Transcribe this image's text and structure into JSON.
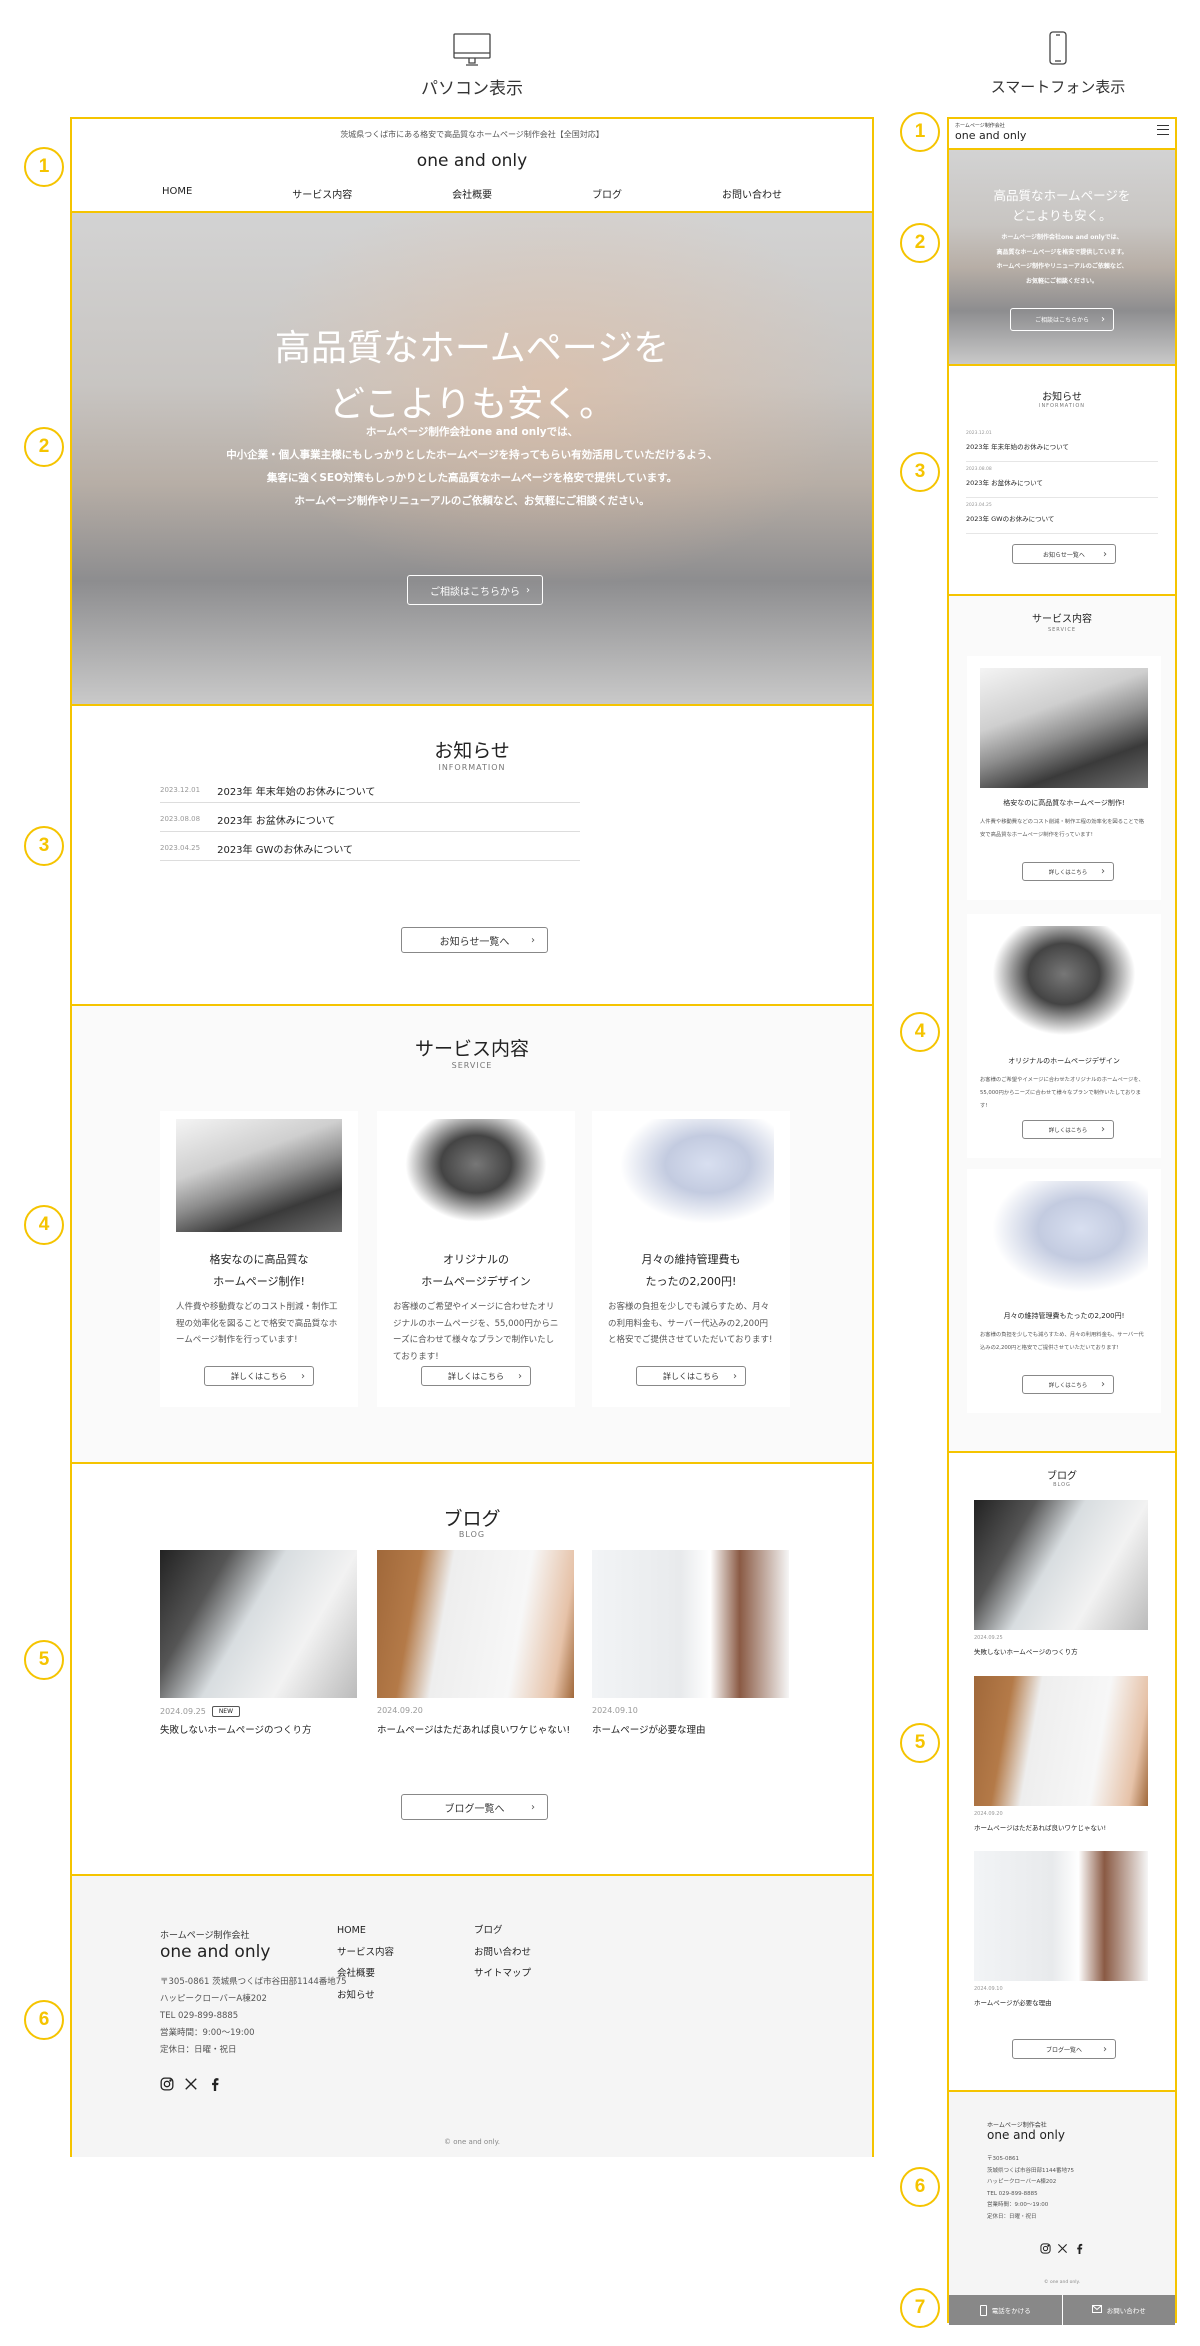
{
  "labels": {
    "pc": "パソコン表示",
    "sp": "スマートフォン表示"
  },
  "markers": [
    "1",
    "2",
    "3",
    "4",
    "5",
    "6",
    "7"
  ],
  "colors": {
    "accent": "#F5C400",
    "footer_bg": "#f5f5f5",
    "sp_bar": "#888888"
  },
  "header": {
    "tagline": "茨城県つくば市にある格安で高品質なホームページ制作会社【全国対応】",
    "logo": "one and only",
    "sp_tagline": "ホームページ制作会社",
    "nav": [
      "HOME",
      "サービス内容",
      "会社概要",
      "ブログ",
      "お問い合わせ"
    ]
  },
  "hero": {
    "title_lines": [
      "高品質なホームページを",
      "どこよりも安く。"
    ],
    "text_lines": [
      "ホームページ制作会社one and onlyでは、",
      "中小企業・個人事業主様にもしっかりとしたホームページを持ってもらい有効活用していただけるよう、",
      "集客に強くSEO対策もしっかりとした高品質なホームページを格安で提供しています。",
      "ホームページ制作やリニューアルのご依頼など、お気軽にご相談ください。"
    ],
    "sp_text_lines": [
      "ホームページ制作会社one and onlyでは、",
      "高品質なホームページを格安で提供しています。",
      "ホームページ制作やリニューアルのご依頼など、",
      "お気軽にご相談ください。"
    ],
    "button": "ご相談はこちらから"
  },
  "news": {
    "title": "お知らせ",
    "sub": "INFORMATION",
    "items": [
      {
        "date": "2023.12.01",
        "title": "2023年 年末年始のお休みについて"
      },
      {
        "date": "2023.08.08",
        "title": "2023年 お盆休みについて"
      },
      {
        "date": "2023.04.25",
        "title": "2023年 GWのお休みについて"
      }
    ],
    "button": "お知らせ一覧へ"
  },
  "service": {
    "title": "サービス内容",
    "sub": "SERVICE",
    "items": [
      {
        "title_lines": [
          "格安なのに高品質な",
          "ホームページ制作!"
        ],
        "body": "人件費や移動費などのコスト削減・制作工程の効率化を図ることで格安で高品質なホームページ制作を行っています!",
        "image": "laptop-keyboard"
      },
      {
        "title_lines": [
          "オリジナルの",
          "ホームページデザイン"
        ],
        "body": "お客様のご希望やイメージに合わせたオリジナルのホームページを、55,000円からニーズに合わせて様々なプランで制作いたしております!",
        "image": "responsive-devices"
      },
      {
        "title_lines": [
          "月々の維持管理費も",
          "たったの2,200円!"
        ],
        "body": "お客様の負担を少しでも減らすため、月々の利用料金も、サーバー代込みの2,200円と格安でご提供させていただいております!",
        "image": "calculator-hand"
      }
    ],
    "button": "詳しくはこちら"
  },
  "blog": {
    "title": "ブログ",
    "sub": "BLOG",
    "items": [
      {
        "date": "2024.09.25",
        "badge": "NEW",
        "title": "失敗しないホームページのつくり方",
        "image": "laptop-coffee"
      },
      {
        "date": "2024.09.20",
        "title": "ホームページはただあれば良いワケじゃない!",
        "image": "typing-hands"
      },
      {
        "date": "2024.09.10",
        "title": "ホームページが必要な理由",
        "image": "woman-laptop"
      }
    ],
    "button": "ブログ一覧へ"
  },
  "footer": {
    "company": "ホームページ制作会社",
    "logo": "one and only",
    "address_lines": [
      "〒305-0861 茨城県つくば市谷田部1144番地75",
      "ハッピークローバーA棟202",
      "TEL 029-899-8885",
      "営業時間：9:00〜19:00",
      "定休日：日曜・祝日"
    ],
    "sp_address_lines": [
      "〒305-0861",
      "茨城県つくば市谷田部1144番地75",
      "ハッピークローバーA棟202",
      "TEL 029-899-8885",
      "営業時間：9:00〜19:00",
      "定休日：日曜・祝日"
    ],
    "menu_col1": [
      "HOME",
      "サービス内容",
      "会社概要",
      "お知らせ"
    ],
    "menu_col2": [
      "ブログ",
      "お問い合わせ",
      "サイトマップ"
    ],
    "social": [
      "instagram",
      "x",
      "facebook"
    ],
    "copyright": "© one and only."
  },
  "sp_bar": {
    "call": "電話をかける",
    "contact": "お問い合わせ"
  }
}
